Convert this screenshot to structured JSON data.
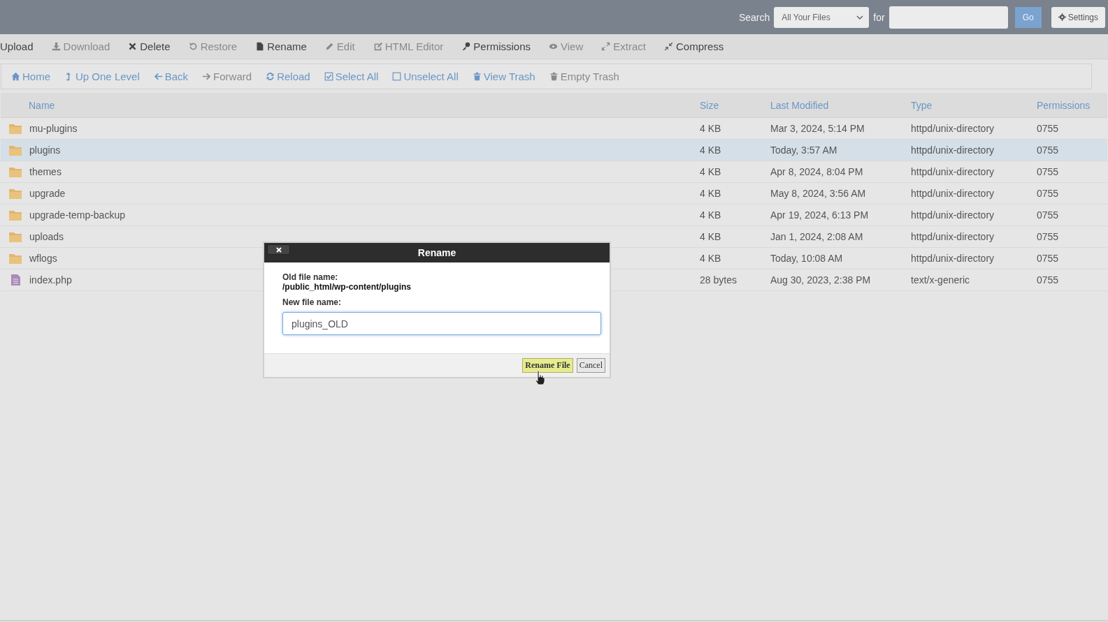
{
  "top_bar": {
    "search_label": "Search",
    "search_scope": "All Your Files",
    "for_label": "for",
    "go_button": "Go",
    "settings_button": "Settings"
  },
  "actions": [
    {
      "label": "Upload",
      "disabled": false
    },
    {
      "label": "Download",
      "disabled": true
    },
    {
      "label": "Delete",
      "disabled": false
    },
    {
      "label": "Restore",
      "disabled": true
    },
    {
      "label": "Rename",
      "disabled": false
    },
    {
      "label": "Edit",
      "disabled": true
    },
    {
      "label": "HTML Editor",
      "disabled": true
    },
    {
      "label": "Permissions",
      "disabled": false
    },
    {
      "label": "View",
      "disabled": true
    },
    {
      "label": "Extract",
      "disabled": true
    },
    {
      "label": "Compress",
      "disabled": false
    }
  ],
  "navigation": [
    {
      "label": "Home",
      "disabled": false
    },
    {
      "label": "Up One Level",
      "disabled": false
    },
    {
      "label": "Back",
      "disabled": false
    },
    {
      "label": "Forward",
      "disabled": true
    },
    {
      "label": "Reload",
      "disabled": false
    },
    {
      "label": "Select All",
      "disabled": false
    },
    {
      "label": "Unselect All",
      "disabled": false
    },
    {
      "label": "View Trash",
      "disabled": false
    },
    {
      "label": "Empty Trash",
      "disabled": true
    }
  ],
  "table": {
    "columns": [
      "Name",
      "Size",
      "Last Modified",
      "Type",
      "Permissions"
    ],
    "rows": [
      {
        "kind": "folder",
        "name": "mu-plugins",
        "size": "4 KB",
        "modified": "Mar 3, 2024, 5:14 PM",
        "type": "httpd/unix-directory",
        "permissions": "0755",
        "selected": false
      },
      {
        "kind": "folder",
        "name": "plugins",
        "size": "4 KB",
        "modified": "Today, 3:57 AM",
        "type": "httpd/unix-directory",
        "permissions": "0755",
        "selected": true
      },
      {
        "kind": "folder",
        "name": "themes",
        "size": "4 KB",
        "modified": "Apr 8, 2024, 8:04 PM",
        "type": "httpd/unix-directory",
        "permissions": "0755",
        "selected": false
      },
      {
        "kind": "folder",
        "name": "upgrade",
        "size": "4 KB",
        "modified": "May 8, 2024, 3:56 AM",
        "type": "httpd/unix-directory",
        "permissions": "0755",
        "selected": false
      },
      {
        "kind": "folder",
        "name": "upgrade-temp-backup",
        "size": "4 KB",
        "modified": "Apr 19, 2024, 6:13 PM",
        "type": "httpd/unix-directory",
        "permissions": "0755",
        "selected": false
      },
      {
        "kind": "folder",
        "name": "uploads",
        "size": "4 KB",
        "modified": "Jan 1, 2024, 2:08 AM",
        "type": "httpd/unix-directory",
        "permissions": "0755",
        "selected": false
      },
      {
        "kind": "folder",
        "name": "wflogs",
        "size": "4 KB",
        "modified": "Today, 10:08 AM",
        "type": "httpd/unix-directory",
        "permissions": "0755",
        "selected": false
      },
      {
        "kind": "file",
        "name": "index.php",
        "size": "28 bytes",
        "modified": "Aug 30, 2023, 2:38 PM",
        "type": "text/x-generic",
        "permissions": "0755",
        "selected": false
      }
    ]
  },
  "dialog": {
    "title": "Rename",
    "old_label": "Old file name:",
    "old_value": "/public_html/wp-content/plugins",
    "new_label": "New file name:",
    "new_value": "plugins_OLD",
    "confirm_button": "Rename File",
    "cancel_button": "Cancel"
  }
}
